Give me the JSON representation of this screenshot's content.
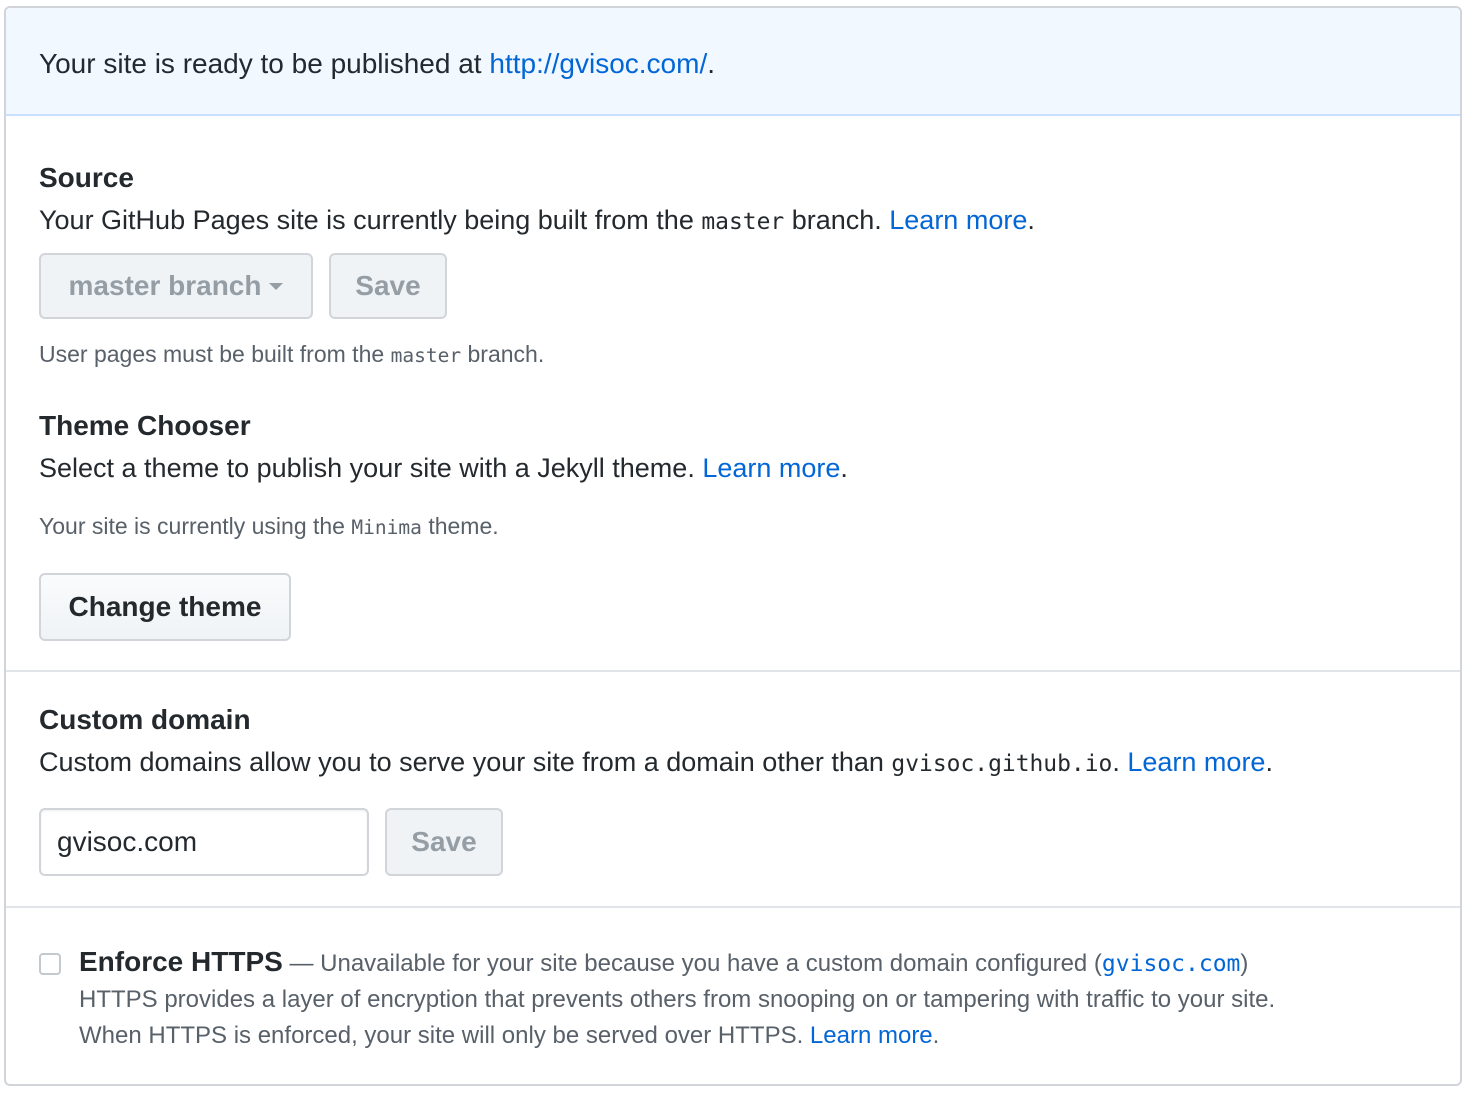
{
  "flash": {
    "prefix": "Your site is ready to be published at ",
    "url": "http://gvisoc.com/",
    "suffix": "."
  },
  "source": {
    "title": "Source",
    "desc_prefix": "Your GitHub Pages site is currently being built from the ",
    "desc_code": "master",
    "desc_mid": " branch. ",
    "learn_more": "Learn more",
    "desc_suffix": ".",
    "branch_select_label": "master branch",
    "save_label": "Save",
    "note_prefix": "User pages must be built from the ",
    "note_code": "master",
    "note_suffix": " branch."
  },
  "theme": {
    "title": "Theme Chooser",
    "desc_prefix": "Select a theme to publish your site with a Jekyll theme. ",
    "learn_more": "Learn more",
    "desc_suffix": ".",
    "note_prefix": "Your site is currently using the ",
    "note_code": "Minima",
    "note_suffix": " theme.",
    "change_button": "Change theme"
  },
  "custom_domain": {
    "title": "Custom domain",
    "desc_prefix": "Custom domains allow you to serve your site from a domain other than ",
    "desc_code": "gvisoc.github.io",
    "desc_mid": ". ",
    "learn_more": "Learn more",
    "desc_suffix": ".",
    "input_value": "gvisoc.com",
    "save_label": "Save"
  },
  "https": {
    "title": "Enforce HTTPS",
    "dash_text": " — Unavailable for your site because you have a custom domain configured (",
    "domain_code": "gvisoc.com",
    "close_paren": ")",
    "line2": "HTTPS provides a layer of encryption that prevents others from snooping on or tampering with traffic to your site.",
    "line3_prefix": "When HTTPS is enforced, your site will only be served over HTTPS. ",
    "learn_more": "Learn more",
    "line3_suffix": ".",
    "checked": false
  },
  "colors": {
    "link": "#0366d6",
    "flash_bg": "#f1f8ff",
    "border": "#d1d5da",
    "muted_text": "#586069"
  }
}
